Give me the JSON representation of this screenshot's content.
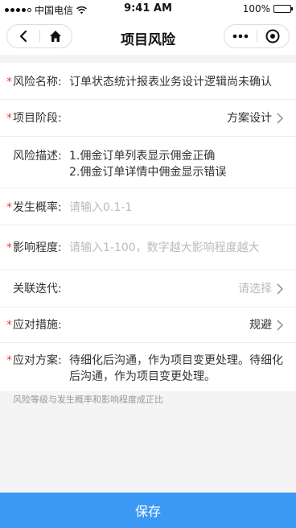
{
  "status_bar": {
    "carrier": "中国电信",
    "time": "9:41 AM",
    "battery": "100%"
  },
  "nav": {
    "title": "项目风险"
  },
  "form": {
    "rows": [
      {
        "label": "风险名称:",
        "required": true,
        "value": "订单状态统计报表业务设计逻辑尚未确认"
      },
      {
        "label": "项目阶段:",
        "required": true,
        "value": "方案设计"
      },
      {
        "label": "风险描述:",
        "required": false,
        "value_lines": [
          "1.佣金订单列表显示佣金正确",
          "2.佣金订单详情中佣金显示错误"
        ]
      },
      {
        "label": "发生概率:",
        "required": true,
        "placeholder": "请输入0.1-1"
      },
      {
        "label": "影响程度:",
        "required": true,
        "placeholder": "请输入1-100，数字越大影响程度越大"
      },
      {
        "label": "关联迭代:",
        "required": false,
        "placeholder": "请选择"
      },
      {
        "label": "应对措施:",
        "required": true,
        "value": "规避"
      },
      {
        "label": "应对方案:",
        "required": true,
        "value": "待细化后沟通，作为项目变更处理。待细化后沟通，作为项目变更处理。"
      }
    ]
  },
  "hint": "风险等级与发生概率和影响程度成正比",
  "save_label": "保存",
  "colors": {
    "accent": "#3b98f4",
    "required": "#e64340"
  }
}
